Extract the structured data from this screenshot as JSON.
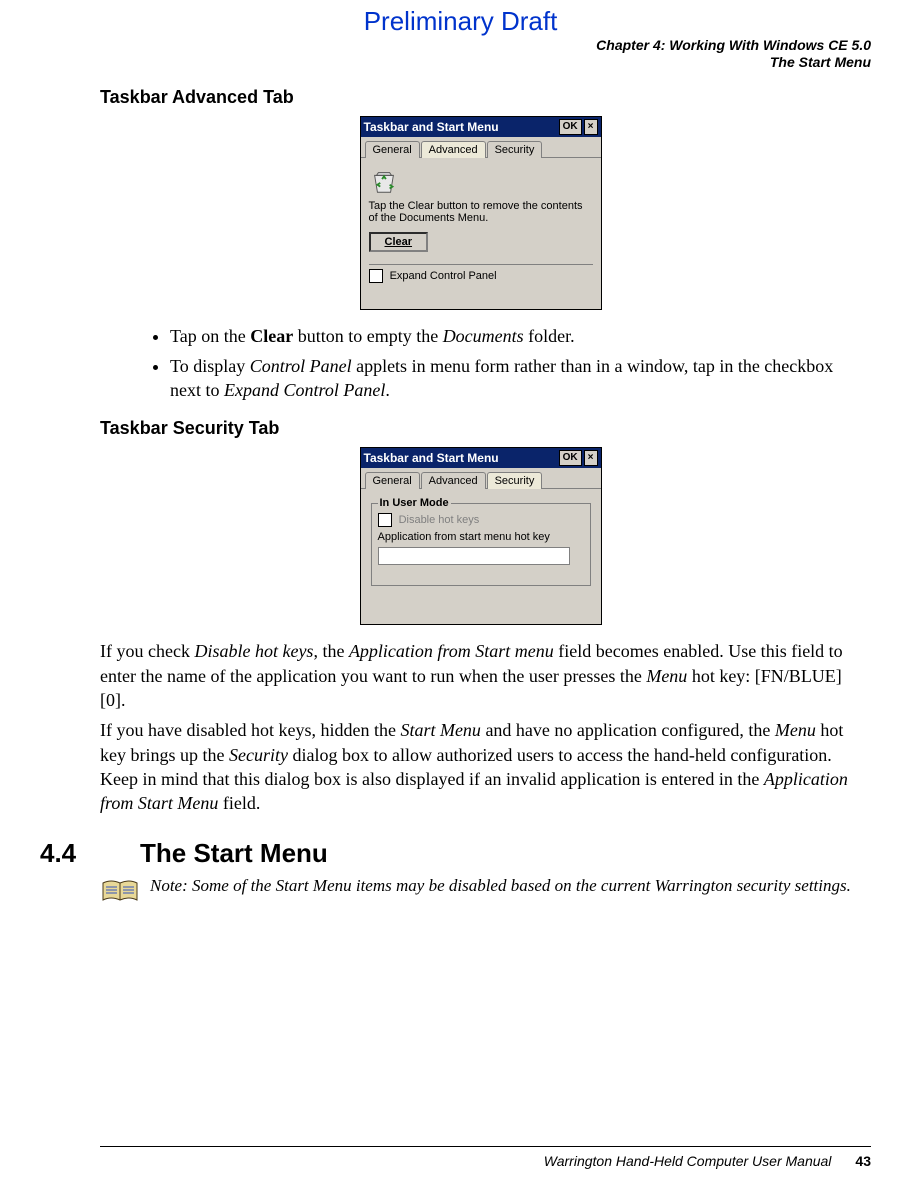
{
  "draft_label": "Preliminary Draft",
  "header": {
    "chapter": "Chapter 4:  Working With Windows CE 5.0",
    "section": "The Start Menu"
  },
  "sh_adv": "Taskbar Advanced Tab",
  "shot1": {
    "title": "Taskbar and Start Menu",
    "ok": "OK",
    "close": "×",
    "tab_general": "General",
    "tab_advanced": "Advanced",
    "tab_security": "Security",
    "desc": "Tap the Clear button to remove the contents of the Documents Menu.",
    "clear": "Clear",
    "expand": "Expand Control Panel"
  },
  "b1_pre": "Tap on the ",
  "b1_bold": "Clear",
  "b1_mid": " button to empty the ",
  "b1_em": "Documents",
  "b1_post": " folder.",
  "b2_pre": "To display ",
  "b2_em1": "Control Panel",
  "b2_mid": " applets in menu form rather than in a window, tap in the checkbox next to ",
  "b2_em2": "Expand Control Panel",
  "b2_post": ".",
  "sh_sec": "Taskbar Security Tab",
  "shot2": {
    "title": "Taskbar and Start Menu",
    "ok": "OK",
    "close": "×",
    "tab_general": "General",
    "tab_advanced": "Advanced",
    "tab_security": "Security",
    "group_title": "In User Mode",
    "disable": "Disable hot keys",
    "app_label": "Application from start menu hot key"
  },
  "p1_a": "If you check ",
  "p1_em1": "Disable hot keys",
  "p1_b": ", the ",
  "p1_em2": "Application from Start menu",
  "p1_c": " field becomes enabled. Use this field to enter the name of the application you want to run when the user presses the ",
  "p1_em3": "Menu",
  "p1_d": " hot key: [FN/BLUE] [0].",
  "p2_a": "If you have disabled hot keys, hidden the ",
  "p2_em1": "Start Menu",
  "p2_b": " and have no application configured, the ",
  "p2_em2": "Menu",
  "p2_c": " hot key brings up the ",
  "p2_em3": "Security",
  "p2_d": " dialog box to allow authorized users to access the hand-held configuration. Keep in mind that this dialog box is also displayed if an invalid application is entered in the ",
  "p2_em4": "Application from Start Menu",
  "p2_e": " field.",
  "sec_num": "4.4",
  "sec_title": "The Start Menu",
  "note_label": "Note: ",
  "note_body": "Some of the Start Menu items may be disabled based on the current Warrington security settings.",
  "footer": {
    "manual": "Warrington Hand-Held Computer User Manual",
    "page": "43"
  }
}
